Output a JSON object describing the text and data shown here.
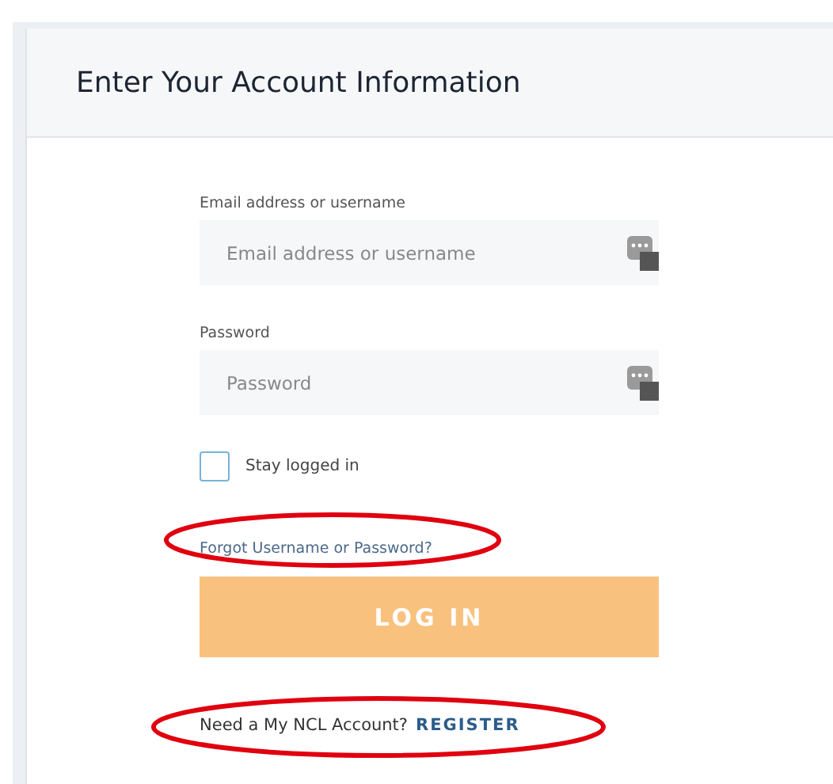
{
  "header": {
    "title": "Enter Your Account Information"
  },
  "fields": [
    {
      "label": "Email address or username",
      "placeholder": "Email address or username"
    },
    {
      "label": "Password",
      "placeholder": "Password"
    }
  ],
  "stay_logged_in": {
    "label": "Stay logged in",
    "checked": false
  },
  "forgot_link": {
    "text": "Forgot Username or Password?",
    "circled": true
  },
  "login_button": {
    "label": "LOG IN"
  },
  "register": {
    "prompt": "Need a My NCL Account?",
    "link": "REGISTER",
    "circled": true
  }
}
